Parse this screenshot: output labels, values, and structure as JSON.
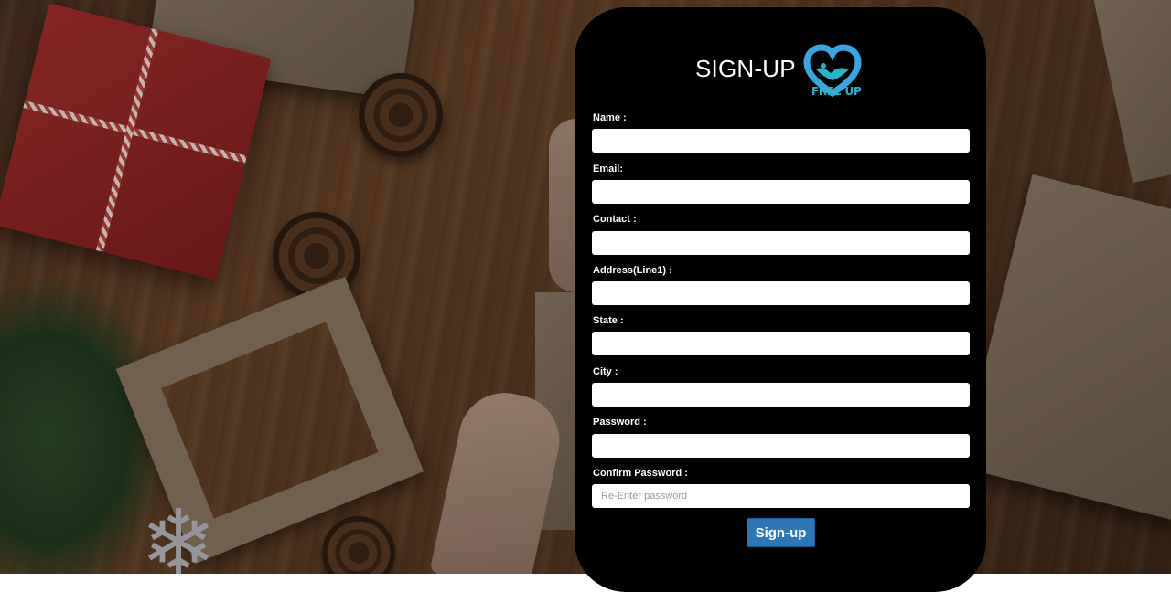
{
  "header": {
    "title": "SIGN-UP",
    "logo_text": "FREE UP",
    "logo_icon": "heart-logo-icon",
    "logo_color": "#3aa6e0"
  },
  "form": {
    "fields": [
      {
        "label": "Name :",
        "value": "",
        "placeholder": ""
      },
      {
        "label": "Email:",
        "value": "",
        "placeholder": ""
      },
      {
        "label": "Contact :",
        "value": "",
        "placeholder": ""
      },
      {
        "label": "Address(Line1) :",
        "value": "",
        "placeholder": ""
      },
      {
        "label": "State :",
        "value": "",
        "placeholder": ""
      },
      {
        "label": "City :",
        "value": "",
        "placeholder": ""
      },
      {
        "label": "Password :",
        "value": "",
        "placeholder": ""
      },
      {
        "label": "Confirm Password :",
        "value": "",
        "placeholder": "Re-Enter password"
      }
    ],
    "submit_label": "Sign-up",
    "submit_color": "#2c77b8"
  },
  "colors": {
    "card_background": "#000000",
    "label_text": "#ffffff",
    "logo_text": "#23b6c9"
  }
}
